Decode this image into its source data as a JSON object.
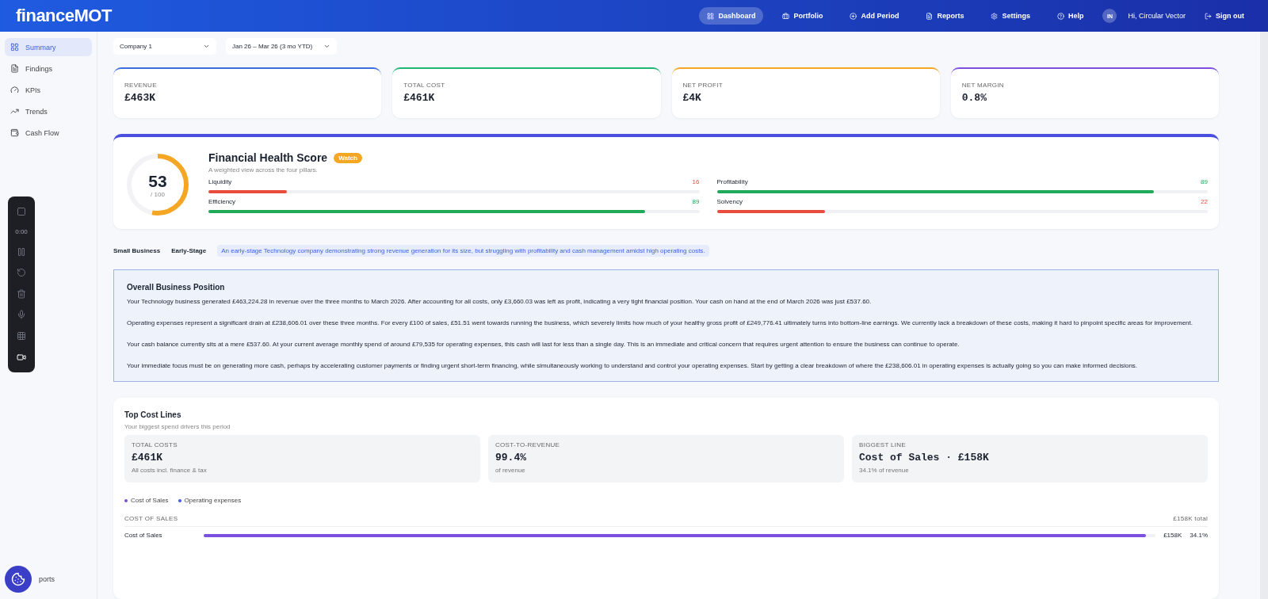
{
  "brand": {
    "part1": "finance",
    "part2": "MOT"
  },
  "nav": [
    {
      "label": "Dashboard",
      "selected": true
    },
    {
      "label": "Portfolio",
      "selected": false
    },
    {
      "label": "Add Period",
      "selected": false
    },
    {
      "label": "Reports",
      "selected": false
    },
    {
      "label": "Settings",
      "selected": false
    },
    {
      "label": "Help",
      "selected": false
    }
  ],
  "user": {
    "initials": "IN",
    "greeting": "Hi, Circular Vector",
    "signout": "Sign out"
  },
  "sidebar": {
    "items": [
      {
        "label": "Summary",
        "selected": true
      },
      {
        "label": "Findings",
        "selected": false
      },
      {
        "label": "KPIs",
        "selected": false
      },
      {
        "label": "Trends",
        "selected": false
      },
      {
        "label": "Cash Flow",
        "selected": false
      }
    ],
    "bottom_item": "ports"
  },
  "recorder": {
    "time": "0:00"
  },
  "filters": [
    {
      "value": "Company 1"
    },
    {
      "value": "Jan 26 – Mar 26 (3 mo YTD)"
    }
  ],
  "kpis": [
    {
      "label": "REVENUE",
      "value": "£463K",
      "color": "#3b6fe0"
    },
    {
      "label": "TOTAL COST",
      "value": "£461K",
      "color": "#22b573"
    },
    {
      "label": "NET PROFIT",
      "value": "£4K",
      "color": "#f5a623"
    },
    {
      "label": "NET MARGIN",
      "value": "0.8%",
      "color": "#7b4fe0"
    }
  ],
  "health": {
    "score": "53",
    "out_of": "/ 100",
    "level": 0.53,
    "title": "Financial Health Score",
    "badge": "Watch",
    "subtitle": "A weighted view across the four pillars.",
    "pillars": [
      {
        "name": "Liquidity",
        "reading": "16",
        "level": 0.16,
        "color": "#e74c3c"
      },
      {
        "name": "Profitability",
        "reading": "89",
        "level": 0.89,
        "color": "#1faa59"
      },
      {
        "name": "Efficiency",
        "reading": "89",
        "level": 0.89,
        "color": "#1faa59"
      },
      {
        "name": "Solvency",
        "reading": "22",
        "level": 0.22,
        "color": "#e74c3c"
      }
    ]
  },
  "tags": [
    "Small Business",
    "Early-Stage"
  ],
  "summary_tag": "An early-stage Technology company demonstrating strong revenue generation for its size, but struggling with profitability and cash management amidst high operating costs.",
  "overview": {
    "title": "Overall Business Position",
    "paragraphs": [
      "Your Technology business generated £463,224.28 in revenue over the three months to March 2026. After accounting for all costs, only £3,660.03 was left as profit, indicating a very tight financial position. Your cash on hand at the end of March 2026 was just £537.60.",
      "Operating expenses represent a significant drain at £238,606.01 over these three months. For every £100 of sales, £51.51 went towards running the business, which severely limits how much of your healthy gross profit of £249,776.41 ultimately turns into bottom-line earnings. We currently lack a breakdown of these costs, making it hard to pinpoint specific areas for improvement.",
      "Your cash balance currently sits at a mere £537.60. At your current average monthly spend of around £79,535 for operating expenses, this cash will last for less than a single day. This is an immediate and critical concern that requires urgent attention to ensure the business can continue to operate.",
      "Your immediate focus must be on generating more cash, perhaps by accelerating customer payments or finding urgent short-term financing, while simultaneously working to understand and control your operating expenses. Start by getting a clear breakdown of where the £238,606.01 in operating expenses is actually going so you can make informed decisions."
    ]
  },
  "cost_lines": {
    "title": "Top Cost Lines",
    "subtitle": "Your biggest spend drivers this period",
    "stats": [
      {
        "label": "TOTAL COSTS",
        "value": "£461K",
        "note": "All costs incl. finance & tax"
      },
      {
        "label": "COST-TO-REVENUE",
        "value": "99.4%",
        "note": "of revenue"
      },
      {
        "label": "BIGGEST LINE",
        "value": "Cost of Sales · £158K",
        "note": "34.1% of revenue"
      }
    ],
    "legend": [
      {
        "label": "Cost of Sales",
        "color": "#7b4fe0"
      },
      {
        "label": "Operating expenses",
        "color": "#3b5fe0"
      }
    ],
    "group": {
      "title": "COST OF SALES",
      "total": "£158K total"
    },
    "rows": [
      {
        "name": "Cost of Sales",
        "level": 0.99,
        "amount": "£158K",
        "share": "34.1%",
        "color": "#7b4fe0"
      }
    ]
  }
}
